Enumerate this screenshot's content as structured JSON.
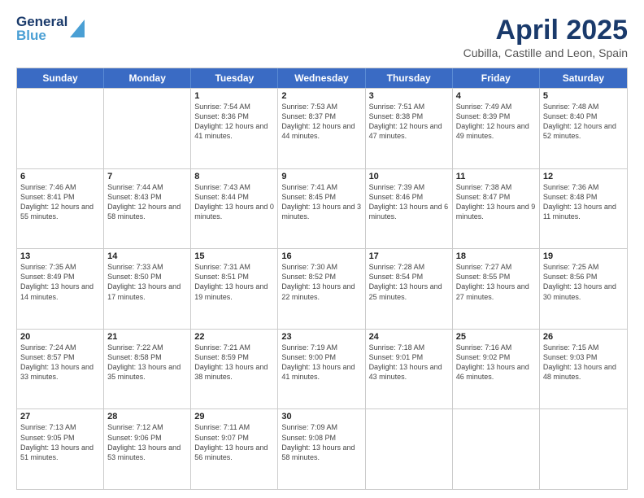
{
  "header": {
    "logo_line1": "General",
    "logo_line2": "Blue",
    "main_title": "April 2025",
    "subtitle": "Cubilla, Castille and Leon, Spain"
  },
  "calendar": {
    "days_of_week": [
      "Sunday",
      "Monday",
      "Tuesday",
      "Wednesday",
      "Thursday",
      "Friday",
      "Saturday"
    ],
    "weeks": [
      [
        {
          "num": "",
          "info": ""
        },
        {
          "num": "",
          "info": ""
        },
        {
          "num": "1",
          "info": "Sunrise: 7:54 AM\nSunset: 8:36 PM\nDaylight: 12 hours and 41 minutes."
        },
        {
          "num": "2",
          "info": "Sunrise: 7:53 AM\nSunset: 8:37 PM\nDaylight: 12 hours and 44 minutes."
        },
        {
          "num": "3",
          "info": "Sunrise: 7:51 AM\nSunset: 8:38 PM\nDaylight: 12 hours and 47 minutes."
        },
        {
          "num": "4",
          "info": "Sunrise: 7:49 AM\nSunset: 8:39 PM\nDaylight: 12 hours and 49 minutes."
        },
        {
          "num": "5",
          "info": "Sunrise: 7:48 AM\nSunset: 8:40 PM\nDaylight: 12 hours and 52 minutes."
        }
      ],
      [
        {
          "num": "6",
          "info": "Sunrise: 7:46 AM\nSunset: 8:41 PM\nDaylight: 12 hours and 55 minutes."
        },
        {
          "num": "7",
          "info": "Sunrise: 7:44 AM\nSunset: 8:43 PM\nDaylight: 12 hours and 58 minutes."
        },
        {
          "num": "8",
          "info": "Sunrise: 7:43 AM\nSunset: 8:44 PM\nDaylight: 13 hours and 0 minutes."
        },
        {
          "num": "9",
          "info": "Sunrise: 7:41 AM\nSunset: 8:45 PM\nDaylight: 13 hours and 3 minutes."
        },
        {
          "num": "10",
          "info": "Sunrise: 7:39 AM\nSunset: 8:46 PM\nDaylight: 13 hours and 6 minutes."
        },
        {
          "num": "11",
          "info": "Sunrise: 7:38 AM\nSunset: 8:47 PM\nDaylight: 13 hours and 9 minutes."
        },
        {
          "num": "12",
          "info": "Sunrise: 7:36 AM\nSunset: 8:48 PM\nDaylight: 13 hours and 11 minutes."
        }
      ],
      [
        {
          "num": "13",
          "info": "Sunrise: 7:35 AM\nSunset: 8:49 PM\nDaylight: 13 hours and 14 minutes."
        },
        {
          "num": "14",
          "info": "Sunrise: 7:33 AM\nSunset: 8:50 PM\nDaylight: 13 hours and 17 minutes."
        },
        {
          "num": "15",
          "info": "Sunrise: 7:31 AM\nSunset: 8:51 PM\nDaylight: 13 hours and 19 minutes."
        },
        {
          "num": "16",
          "info": "Sunrise: 7:30 AM\nSunset: 8:52 PM\nDaylight: 13 hours and 22 minutes."
        },
        {
          "num": "17",
          "info": "Sunrise: 7:28 AM\nSunset: 8:54 PM\nDaylight: 13 hours and 25 minutes."
        },
        {
          "num": "18",
          "info": "Sunrise: 7:27 AM\nSunset: 8:55 PM\nDaylight: 13 hours and 27 minutes."
        },
        {
          "num": "19",
          "info": "Sunrise: 7:25 AM\nSunset: 8:56 PM\nDaylight: 13 hours and 30 minutes."
        }
      ],
      [
        {
          "num": "20",
          "info": "Sunrise: 7:24 AM\nSunset: 8:57 PM\nDaylight: 13 hours and 33 minutes."
        },
        {
          "num": "21",
          "info": "Sunrise: 7:22 AM\nSunset: 8:58 PM\nDaylight: 13 hours and 35 minutes."
        },
        {
          "num": "22",
          "info": "Sunrise: 7:21 AM\nSunset: 8:59 PM\nDaylight: 13 hours and 38 minutes."
        },
        {
          "num": "23",
          "info": "Sunrise: 7:19 AM\nSunset: 9:00 PM\nDaylight: 13 hours and 41 minutes."
        },
        {
          "num": "24",
          "info": "Sunrise: 7:18 AM\nSunset: 9:01 PM\nDaylight: 13 hours and 43 minutes."
        },
        {
          "num": "25",
          "info": "Sunrise: 7:16 AM\nSunset: 9:02 PM\nDaylight: 13 hours and 46 minutes."
        },
        {
          "num": "26",
          "info": "Sunrise: 7:15 AM\nSunset: 9:03 PM\nDaylight: 13 hours and 48 minutes."
        }
      ],
      [
        {
          "num": "27",
          "info": "Sunrise: 7:13 AM\nSunset: 9:05 PM\nDaylight: 13 hours and 51 minutes."
        },
        {
          "num": "28",
          "info": "Sunrise: 7:12 AM\nSunset: 9:06 PM\nDaylight: 13 hours and 53 minutes."
        },
        {
          "num": "29",
          "info": "Sunrise: 7:11 AM\nSunset: 9:07 PM\nDaylight: 13 hours and 56 minutes."
        },
        {
          "num": "30",
          "info": "Sunrise: 7:09 AM\nSunset: 9:08 PM\nDaylight: 13 hours and 58 minutes."
        },
        {
          "num": "",
          "info": ""
        },
        {
          "num": "",
          "info": ""
        },
        {
          "num": "",
          "info": ""
        }
      ]
    ]
  }
}
